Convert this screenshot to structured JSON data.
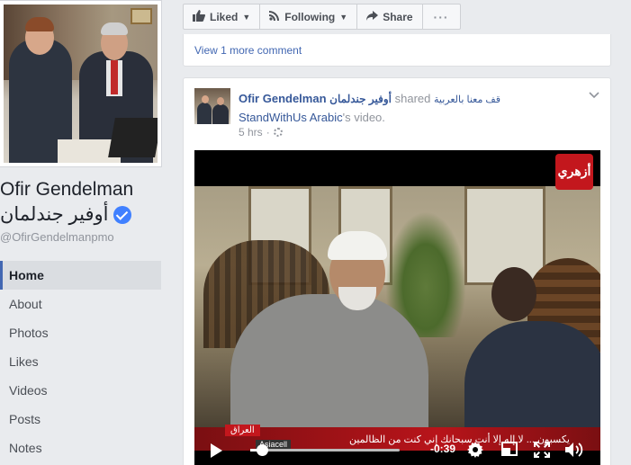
{
  "profile": {
    "name": "Ofir Gendelman",
    "name_ar": "أوفير جندلمان",
    "handle": "@OfirGendelmanpmo"
  },
  "nav": {
    "items": [
      {
        "label": "Home",
        "active": true
      },
      {
        "label": "About"
      },
      {
        "label": "Photos"
      },
      {
        "label": "Likes"
      },
      {
        "label": "Videos"
      },
      {
        "label": "Posts"
      },
      {
        "label": "Notes"
      }
    ]
  },
  "action_bar": {
    "liked": "Liked",
    "following": "Following",
    "share": "Share",
    "more": "···"
  },
  "comments": {
    "view_more": "View 1 more comment"
  },
  "post": {
    "author": "Ofir Gendelman",
    "author_ar": "أوفير جندلمان",
    "shared_word": "shared",
    "page_ar": "قف معنا بالعربية",
    "page_en": "StandWithUs Arabic",
    "suffix": "'s video.",
    "time": "5 hrs",
    "dot": "·"
  },
  "video": {
    "caption_text": "يكسبون ... لا إله إلا أنت سبحانك إني كنت من الظالمين",
    "station_label": "العراق",
    "station_sub": "Asiacell",
    "channel_logo": "أزهري",
    "time_left": "-0:39",
    "progress": 0.08
  },
  "colors": {
    "link": "#365899",
    "accent": "#4267b2",
    "verified": "#4080ff"
  }
}
